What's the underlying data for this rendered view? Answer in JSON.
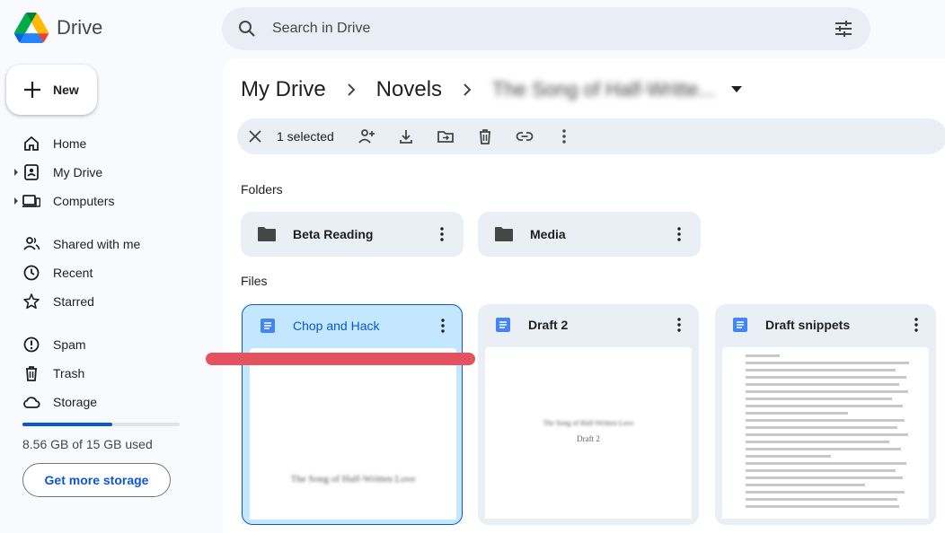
{
  "app": {
    "name": "Drive"
  },
  "search": {
    "placeholder": "Search in Drive"
  },
  "new_button": {
    "label": "New"
  },
  "nav": {
    "group1": [
      {
        "label": "Home",
        "icon": "home-icon"
      },
      {
        "label": "My Drive",
        "icon": "my-drive-icon"
      },
      {
        "label": "Computers",
        "icon": "computers-icon"
      }
    ],
    "group2": [
      {
        "label": "Shared with me",
        "icon": "shared-icon"
      },
      {
        "label": "Recent",
        "icon": "clock-icon"
      },
      {
        "label": "Starred",
        "icon": "star-icon"
      }
    ],
    "group3": [
      {
        "label": "Spam",
        "icon": "spam-icon"
      },
      {
        "label": "Trash",
        "icon": "trash-icon"
      },
      {
        "label": "Storage",
        "icon": "cloud-icon"
      }
    ]
  },
  "storage": {
    "used_text": "8.56 GB of 15 GB used",
    "used_fraction": 0.57,
    "get_more_label": "Get more storage"
  },
  "breadcrumb": {
    "root": "My Drive",
    "folder": "Novels",
    "current": "The Song of Half-Writte..."
  },
  "selection_bar": {
    "count_label": "1 selected"
  },
  "sections": {
    "folders": "Folders",
    "files": "Files"
  },
  "folders": [
    {
      "name": "Beta Reading"
    },
    {
      "name": "Media"
    }
  ],
  "files": [
    {
      "name": "Chop and Hack",
      "selected": true,
      "thumb_text": "The Song of Half-Written Love"
    },
    {
      "name": "Draft 2",
      "selected": false,
      "thumb_title": "The Song of Half-Written Love",
      "thumb_text": "Draft 2"
    },
    {
      "name": "Draft snippets",
      "selected": false
    }
  ],
  "colors": {
    "accent": "#0b57d0",
    "selected_bg": "#c2e7ff",
    "annotation_red": "#e5525f"
  }
}
